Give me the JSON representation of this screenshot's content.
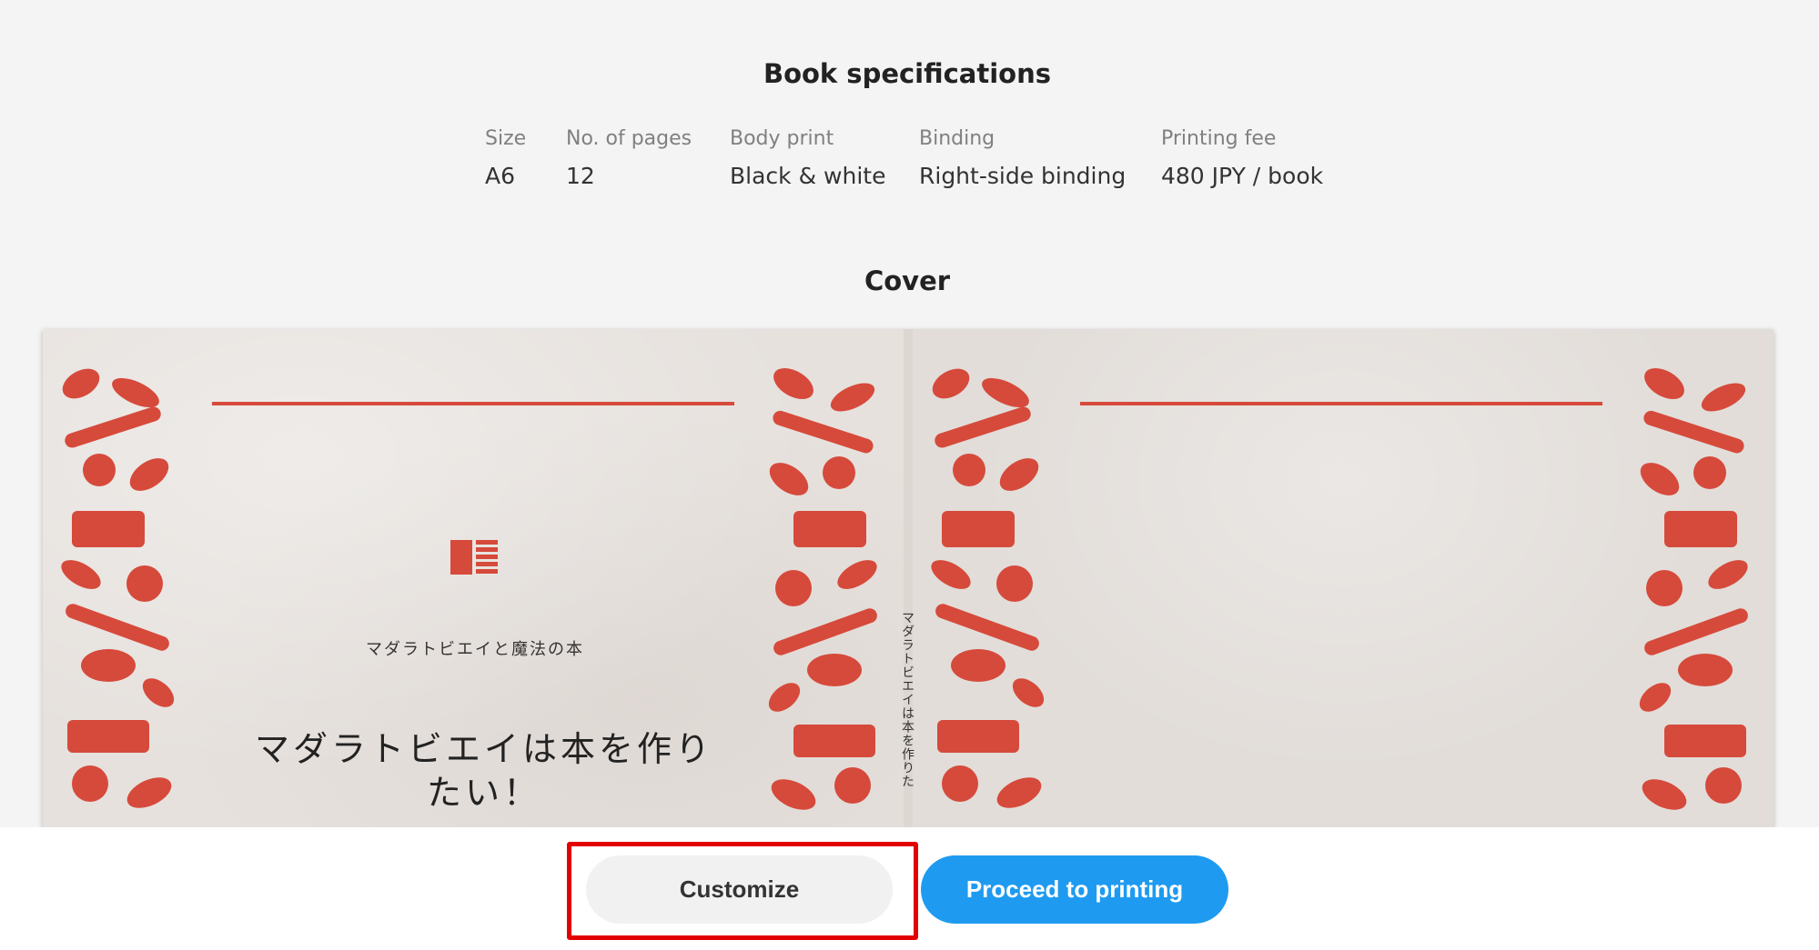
{
  "specs": {
    "title": "Book specifications",
    "columns": [
      {
        "label": "Size",
        "value": "A6"
      },
      {
        "label": "No. of pages",
        "value": "12"
      },
      {
        "label": "Body print",
        "value": "Black & white"
      },
      {
        "label": "Binding",
        "value": "Right-side binding"
      },
      {
        "label": "Printing fee",
        "value": "480 JPY / book"
      }
    ]
  },
  "cover": {
    "title": "Cover",
    "subtitle": "マダラトビエイと魔法の本",
    "book_title": "マダラトビエイは本を作りたい！",
    "spine_text": "マダラトビエイは本を作りた",
    "accent_color": "#d64a3b",
    "icons": [
      "book-logo-icon",
      "floral-ornament"
    ]
  },
  "actions": {
    "customize_label": "Customize",
    "proceed_label": "Proceed to printing",
    "proceed_color": "#1e9bf0",
    "highlight_color": "#e30000"
  }
}
